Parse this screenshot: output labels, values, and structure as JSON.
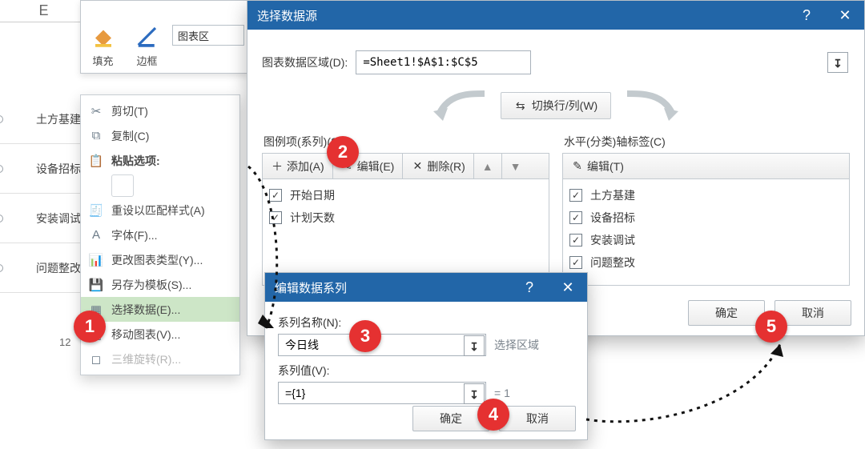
{
  "sheet": {
    "col_header": "E",
    "rows": [
      "土方基建",
      "设备招标",
      "安装调试",
      "问题整改"
    ],
    "row_label_misc": "12"
  },
  "toolbar": {
    "fill": "填充",
    "border": "边框",
    "chart_area": "图表区"
  },
  "context_menu": {
    "cut": "剪切(T)",
    "copy": "复制(C)",
    "paste_label": "粘贴选项:",
    "reset": "重设以匹配样式(A)",
    "font": "字体(F)...",
    "change_type": "更改图表类型(Y)...",
    "save_as_template": "另存为模板(S)...",
    "select_data": "选择数据(E)...",
    "move_chart": "移动图表(V)...",
    "rotate3d": "三维旋转(R)..."
  },
  "sds": {
    "title": "选择数据源",
    "help": "?",
    "close": "✕",
    "range_label": "图表数据区域(D):",
    "range_value": "=Sheet1!$A$1:$C$5",
    "swap": "切换行/列(W)",
    "series_title": "图例项(系列)(S)",
    "cat_title": "水平(分类)轴标签(C)",
    "series_toolbar": {
      "add": "添加(A)",
      "edit": "编辑(E)",
      "remove": "删除(R)"
    },
    "cat_toolbar": {
      "edit": "编辑(T)"
    },
    "series_items": [
      "开始日期",
      "计划天数"
    ],
    "cat_items": [
      "土方基建",
      "设备招标",
      "安装调试",
      "问题整改"
    ],
    "ok": "确定",
    "cancel": "取消"
  },
  "es": {
    "title": "编辑数据系列",
    "help": "?",
    "close": "✕",
    "name_label": "系列名称(N):",
    "name_value": "今日线",
    "name_hint": "选择区域",
    "value_label": "系列值(V):",
    "value_value": "={1}",
    "value_hint": "= 1",
    "ok": "确定",
    "cancel": "取消"
  },
  "badges": {
    "b1": "1",
    "b2": "2",
    "b3": "3",
    "b4": "4",
    "b5": "5"
  }
}
